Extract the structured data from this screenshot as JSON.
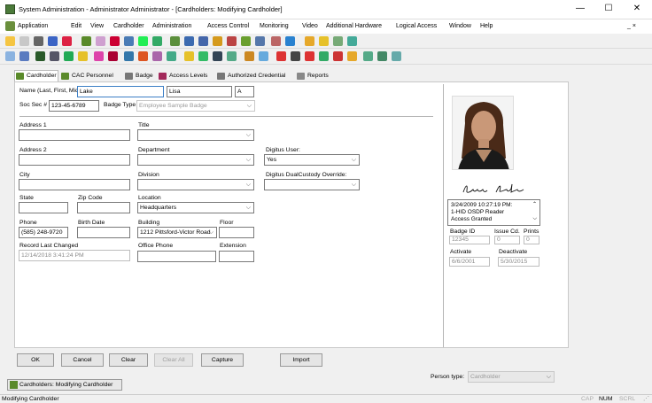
{
  "window": {
    "title": "System Administration - Administrator Administrator - [Cardholders: Modifying Cardholder]",
    "minimize": "—",
    "maximize": "☐",
    "close": "✕",
    "mdi_controls": "_ ×"
  },
  "menu": [
    "Application",
    "Edit",
    "View",
    "Cardholder",
    "Administration",
    "Access Control",
    "Monitoring",
    "Video",
    "Additional Hardware",
    "Logical Access",
    "Window",
    "Help"
  ],
  "tabs": [
    "Cardholder",
    "CAC Personnel",
    "Badge",
    "Access Levels",
    "Authorized Credential",
    "Reports"
  ],
  "form": {
    "name_label": "Name (Last, First, Mid)",
    "last": "Lake",
    "first": "Lisa",
    "mid": "A",
    "ssn_label": "Soc Sec #",
    "ssn": "123-45-6789",
    "badge_type_label": "Badge Type",
    "badge_type": "Employee Sample Badge",
    "address1_label": "Address 1",
    "address1": "",
    "title_label": "Title",
    "title": "",
    "address2_label": "Address 2",
    "address2": "",
    "department_label": "Department",
    "department": "",
    "digitus_user_label": "Digitus User:",
    "digitus_user": "Yes",
    "city_label": "City",
    "city": "",
    "division_label": "Division",
    "division": "",
    "digitus_dual_label": "Digitus DualCustody Override:",
    "digitus_dual": "",
    "state_label": "State",
    "state": "",
    "zip_label": "Zip Code",
    "zip": "",
    "location_label": "Location",
    "location": "Headquarters",
    "phone_label": "Phone",
    "phone": "(585) 248-9720",
    "birth_label": "Birth Date",
    "birth": "",
    "building_label": "Building",
    "building": "1212 Pittsford-Victor Road",
    "floor_label": "Floor",
    "floor": "",
    "record_label": "Record Last Changed",
    "record": "12/14/2018 3:41:24 PM",
    "office_phone_label": "Office Phone",
    "office_phone": "",
    "extension_label": "Extension",
    "extension": ""
  },
  "side": {
    "signature": "Lisa Lake",
    "event_lines": [
      "3/24/2009 10:27:19 PM:",
      "1-HID OSDP Reader",
      "Access Granted"
    ],
    "badge_id_label": "Badge ID",
    "badge_id": "12345",
    "issue_label": "Issue Cd.",
    "issue": "0",
    "prints_label": "Prints",
    "prints": "0",
    "activate_label": "Activate",
    "activate": "6/6/2001",
    "deactivate_label": "Deactivate",
    "deactivate": "5/30/2015"
  },
  "buttons": {
    "ok": "OK",
    "cancel": "Cancel",
    "clear": "Clear",
    "clear_all": "Clear All",
    "capture": "Capture",
    "import": "Import"
  },
  "person_type_label": "Person type:",
  "person_type": "Cardholder",
  "taskbar_item": "Cardholders: Modifying Cardholder",
  "status": {
    "text": "Modifying Cardholder",
    "cap": "CAP",
    "num": "NUM",
    "scrl": "SCRL"
  }
}
